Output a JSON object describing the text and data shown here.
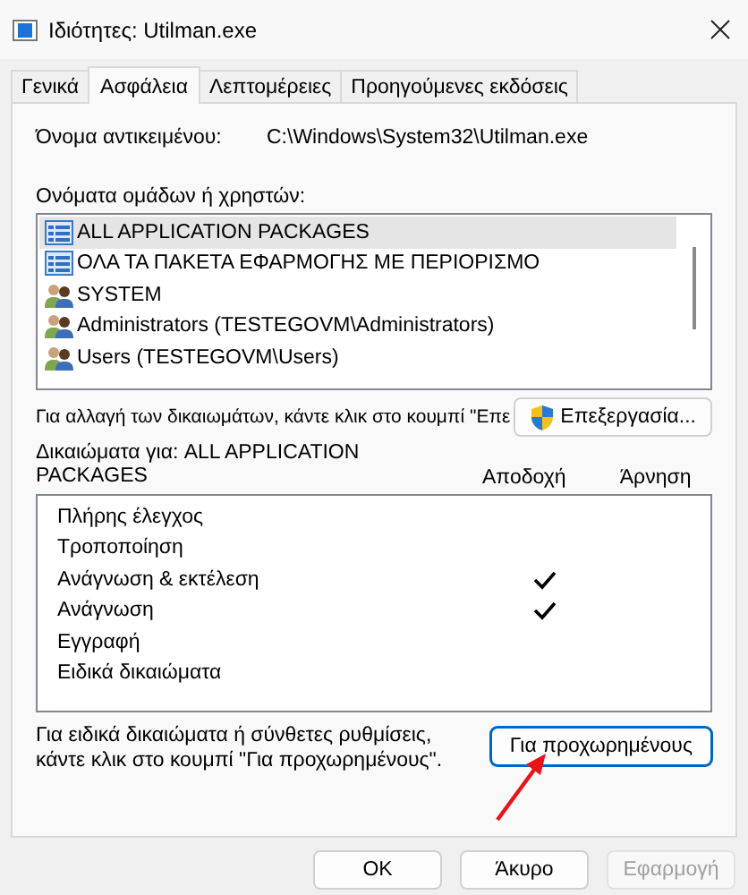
{
  "window": {
    "title": "Ιδιότητες: Utilman.exe"
  },
  "tabs": [
    {
      "label": "Γενικά",
      "selected": false
    },
    {
      "label": "Ασφάλεια",
      "selected": true
    },
    {
      "label": "Λεπτομέρειες",
      "selected": false
    },
    {
      "label": "Προηγούμενες εκδόσεις",
      "selected": false
    }
  ],
  "object_name": {
    "label": "Όνομα αντικειμένου:",
    "value": "C:\\Windows\\System32\\Utilman.exe"
  },
  "groups": {
    "label": "Ονόματα ομάδων ή χρηστών:",
    "items": [
      {
        "name": "ALL APPLICATION PACKAGES",
        "kind": "package",
        "selected": true
      },
      {
        "name": "ΟΛΑ ΤΑ ΠΑΚΕΤΑ ΕΦΑΡΜΟΓΗΣ ΜΕ ΠΕΡΙΟΡΙΣΜΟ",
        "kind": "package",
        "selected": false
      },
      {
        "name": "SYSTEM",
        "kind": "users",
        "selected": false
      },
      {
        "name": "Administrators (TESTEGOVM\\Administrators)",
        "kind": "users",
        "selected": false
      },
      {
        "name": "Users (TESTEGOVM\\Users)",
        "kind": "users",
        "selected": false
      }
    ]
  },
  "edit_hint": "Για αλλαγή των δικαιωμάτων, κάντε κλικ στο κουμπί \"Επε",
  "edit_button": "Επεξεργασία...",
  "permissions": {
    "label": "Δικαιώματα για: ALL APPLICATION PACKAGES",
    "allow_header": "Αποδοχή",
    "deny_header": "Άρνηση",
    "rows": [
      {
        "name": "Πλήρης έλεγχος",
        "allow": false,
        "deny": false
      },
      {
        "name": "Τροποποίηση",
        "allow": false,
        "deny": false
      },
      {
        "name": "Ανάγνωση & εκτέλεση",
        "allow": true,
        "deny": false
      },
      {
        "name": "Ανάγνωση",
        "allow": true,
        "deny": false
      },
      {
        "name": "Εγγραφή",
        "allow": false,
        "deny": false
      },
      {
        "name": "Ειδικά δικαιώματα",
        "allow": false,
        "deny": false
      }
    ]
  },
  "advanced_hint": "Για ειδικά δικαιώματα ή σύνθετες ρυθμίσεις, κάντε κλικ στο κουμπί \"Για προχωρημένους\".",
  "advanced_button": "Για προχωρημένους",
  "buttons": [
    {
      "label": "OK",
      "disabled": false
    },
    {
      "label": "Άκυρο",
      "disabled": false
    },
    {
      "label": "Εφαρμογή",
      "disabled": true
    }
  ]
}
